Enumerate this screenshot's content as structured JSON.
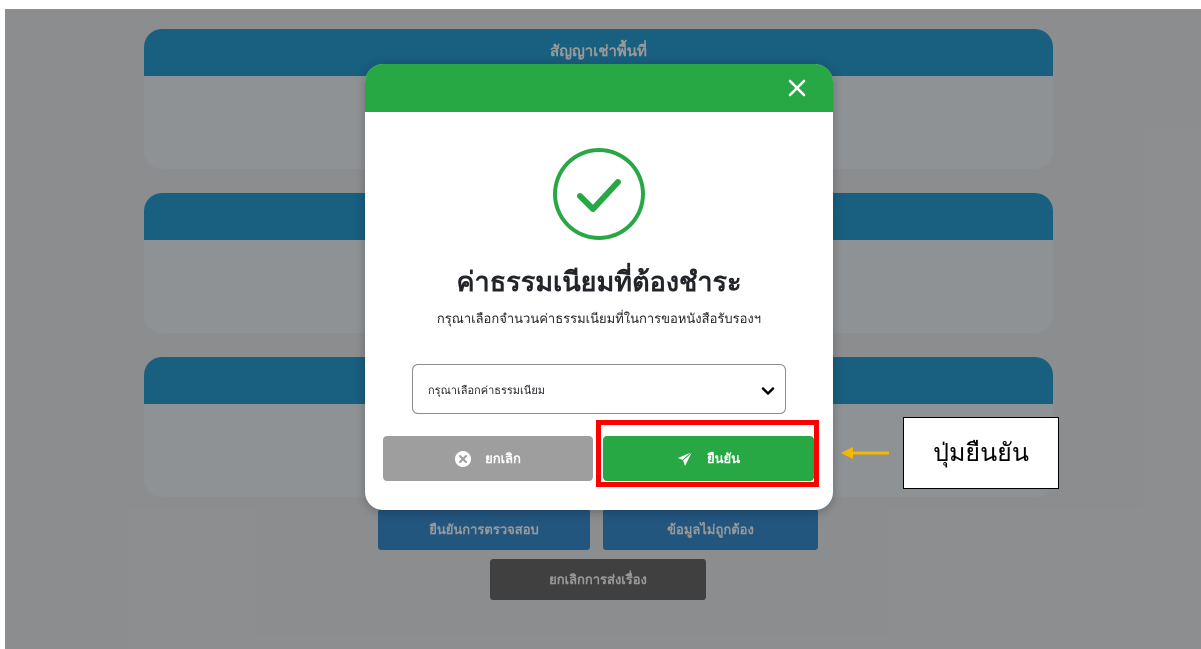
{
  "page": {
    "cards": [
      {
        "title": "สัญญาเช่าพื้นที่"
      },
      {
        "title": ""
      },
      {
        "title": ""
      }
    ],
    "actions": {
      "verify_label": "ยืนยันการตรวจสอบ",
      "incorrect_label": "ข้อมูลไม่ถูกต้อง",
      "cancel_submission_label": "ยกเลิกการส่งเรื่อง"
    }
  },
  "modal": {
    "close_icon": "close-icon",
    "status_icon": "check-circle-icon",
    "title": "ค่าธรรมเนียมที่ต้องชำระ",
    "description": "กรุณาเลือกจำนวนค่าธรรมเนียมที่ในการขอหนังสือรับรองฯ",
    "select": {
      "selected": "กรุณาเลือกค่าธรรมเนียม"
    },
    "cancel_label": "ยกเลิก",
    "confirm_label": "ยืนยัน"
  },
  "annotation": {
    "callout_text": "ปุ่มยืนยัน"
  },
  "colors": {
    "header_green": "#28a745",
    "card_header_blue": "#2a9fd6",
    "highlight_red": "#ff0000",
    "arrow_yellow": "#f5b800"
  }
}
